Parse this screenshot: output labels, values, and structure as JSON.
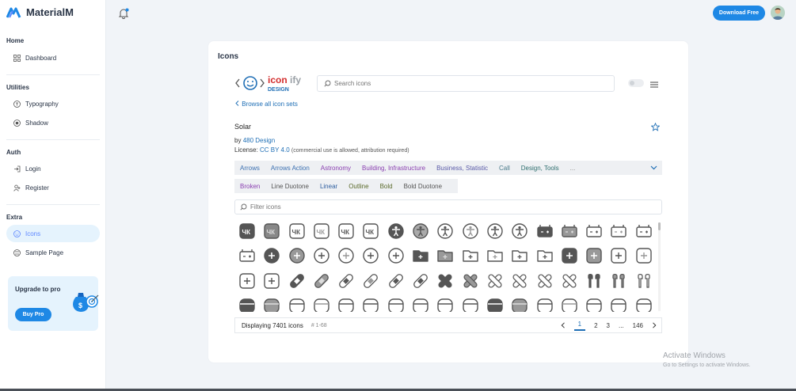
{
  "brand": {
    "name": "MaterialM"
  },
  "sidebar": {
    "sections": [
      {
        "title": "Home",
        "items": [
          {
            "label": "Dashboard",
            "icon": "layout-grid-icon"
          }
        ]
      },
      {
        "title": "Utilities",
        "items": [
          {
            "label": "Typography",
            "icon": "typography-icon"
          },
          {
            "label": "Shadow",
            "icon": "shadow-icon"
          }
        ]
      },
      {
        "title": "Auth",
        "items": [
          {
            "label": "Login",
            "icon": "login-icon"
          },
          {
            "label": "Register",
            "icon": "user-plus-icon"
          }
        ]
      },
      {
        "title": "Extra",
        "items": [
          {
            "label": "Icons",
            "icon": "mood-icon",
            "active": true
          },
          {
            "label": "Sample Page",
            "icon": "aperture-icon"
          }
        ]
      }
    ],
    "upgrade": {
      "title": "Upgrade to pro",
      "button": "Buy Pro"
    }
  },
  "topbar": {
    "download_label": "Download Free"
  },
  "card": {
    "title": "Icons",
    "search_placeholder": "Search icons",
    "browse_link": "Browse all icon sets",
    "set_name": "Solar",
    "by_prefix": "by",
    "author": "480 Design",
    "license_prefix": "License:",
    "license": "CC BY 4.0",
    "license_note": "(commercial use is allowed, attribution required)",
    "categories": [
      {
        "label": "Arrows",
        "color": "#3a6fb0"
      },
      {
        "label": "Arrows Action",
        "color": "#3a6fb0"
      },
      {
        "label": "Astronomy",
        "color": "#8a3fb0"
      },
      {
        "label": "Building, Infrastructure",
        "color": "#8a3fb0"
      },
      {
        "label": "Business, Statistic",
        "color": "#5a5aa8"
      },
      {
        "label": "Call",
        "color": "#4a7a8a"
      },
      {
        "label": "Design, Tools",
        "color": "#2f6f6f"
      },
      {
        "label": "...",
        "color": "#888888"
      }
    ],
    "styles": [
      {
        "label": "Broken",
        "color": "#8a3fb0"
      },
      {
        "label": "Line Duotone",
        "color": "#555555"
      },
      {
        "label": "Linear",
        "color": "#2f5fa0"
      },
      {
        "label": "Outline",
        "color": "#5a6a2a"
      },
      {
        "label": "Bold",
        "color": "#5a6a2a"
      },
      {
        "label": "Bold Duotone",
        "color": "#555555"
      }
    ],
    "filter_placeholder": "Filter icons",
    "displaying": "Displaying 7401 icons",
    "range": "# 1-68",
    "pages": [
      "1",
      "2",
      "3",
      "...",
      "146"
    ]
  },
  "watermark": {
    "line1": "Activate Windows",
    "line2": "Go to Settings to activate Windows."
  }
}
